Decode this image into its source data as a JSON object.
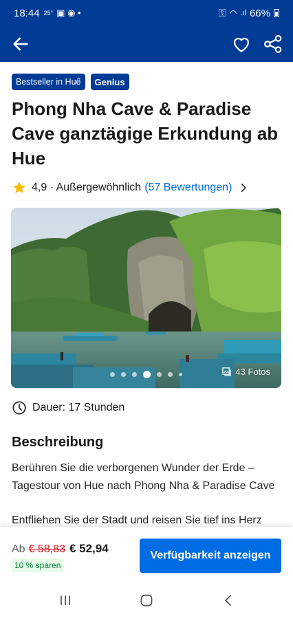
{
  "status_bar": {
    "time": "18:44",
    "temperature": "25°",
    "battery": "66%",
    "icons": [
      "notification-icons",
      "vpn-key-icon",
      "wifi-icon",
      "signal-icon",
      "battery-icon"
    ]
  },
  "nav": {
    "icons": [
      "back-arrow-icon",
      "heart-icon",
      "share-icon"
    ]
  },
  "badges": {
    "bestseller": "Bestseller in Huế",
    "genius": "Genius"
  },
  "title": "Phong Nha Cave & Paradise Cave ganztägige Erkundung ab Hue",
  "rating": {
    "score": "4,9 · Außergewöhnlich",
    "reviews": "(57 Bewertungen)"
  },
  "gallery": {
    "photo_count": "43 Fotos",
    "active_index": 3,
    "dot_count": 7
  },
  "duration": "Dauer: 17 Stunden",
  "description": {
    "heading": "Beschreibung",
    "paragraph1": "Berühren Sie die verborgenen Wunder der Erde – Tagestour von Hue nach Phong Nha & Paradise Cave",
    "paragraph2": "Entfliehen Sie der Stadt und reisen Sie tief ins Herz"
  },
  "booking": {
    "prefix": "Ab",
    "old_price": "€ 58,83",
    "new_price": "€ 52,94",
    "savings": "10 % sparen",
    "cta": "Verfügbarkeit anzeigen"
  },
  "colors": {
    "brand": "#003b95",
    "link": "#006ce4",
    "star": "#febb02",
    "sale": "#d4111e",
    "savings": "#008234"
  }
}
